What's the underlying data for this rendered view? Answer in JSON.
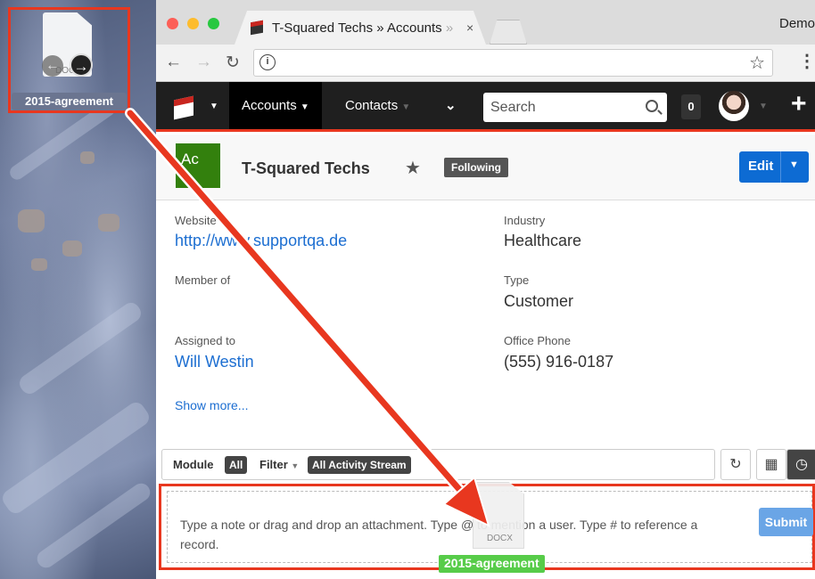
{
  "desktop": {
    "file_name": "2015-agreement",
    "file_ext": "DOC"
  },
  "browser": {
    "tab_title": "T-Squared Techs » Accounts",
    "tab_title_fade": " » ",
    "tab_close": "×",
    "profile_name": "Demo",
    "url_info": "i"
  },
  "navbar": {
    "accounts_label": "Accounts",
    "contacts_label": "Contacts",
    "search_placeholder": "Search",
    "notification_count": "0"
  },
  "record": {
    "module_abbrev": "Ac",
    "name": "T-Squared Techs",
    "following_label": "Following",
    "edit_label": "Edit"
  },
  "fields": {
    "website_label": "Website",
    "website_value": "http://www.supportqa.de",
    "industry_label": "Industry",
    "industry_value": "Healthcare",
    "member_of_label": "Member of",
    "type_label": "Type",
    "type_value": "Customer",
    "assigned_to_label": "Assigned to",
    "assigned_to_value": "Will Westin",
    "office_phone_label": "Office Phone",
    "office_phone_value": "(555) 916-0187",
    "show_more_label": "Show more..."
  },
  "activity": {
    "module_label": "Module",
    "module_value": "All",
    "filter_label": "Filter",
    "filter_value": "All Activity Stream"
  },
  "comment": {
    "placeholder": "Type a note or drag and drop an attachment. Type @ to mention a user. Type # to reference a record.",
    "submit_label": "Submit",
    "drag_ext": "DOCX",
    "drag_label": "2015-agreement"
  },
  "colors": {
    "annotation_red": "#e8371f",
    "accent_blue": "#0d6bd3",
    "module_green": "#33800d",
    "drop_green": "#57cc49"
  }
}
